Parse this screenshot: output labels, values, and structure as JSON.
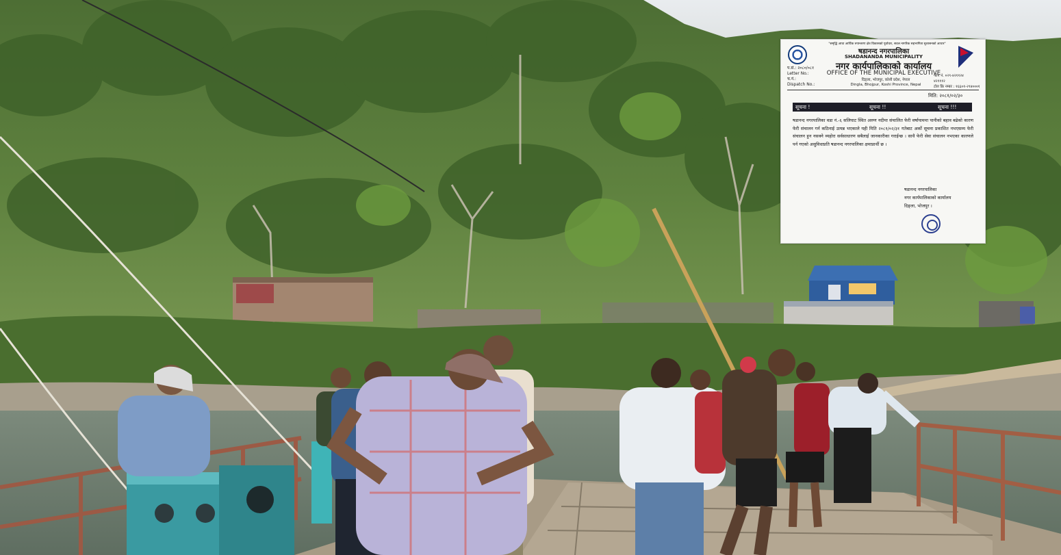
{
  "notice": {
    "slogan": "\"समृद्धि आधा आर्थिक रुपान्तरण क्षेत्र विकासको पूर्वाधार, सवल नागरिक सहभागिता सुशासनको आधार\"",
    "municipality_nepali": "षडानन्द नगरपालिका",
    "municipality_english": "SHADANANDA MUNICIPALITY",
    "office_nepali": "नगर कार्यपालिकाको कार्यालय",
    "office_english": "OFFICE OF THE MUNICIPAL EXECUTIVE",
    "meta_left": [
      "प.सं.: २०८०/०८१",
      "Letter No.:",
      "च.नं.:",
      "Dispatch No.:"
    ],
    "meta_right": [
      "फोन नं. ०२९-४२११२४",
      "४२१११२",
      "टोल फ्रि नम्बर : १६६०१-२९४०००१"
    ],
    "address": [
      "दिङ्ला, भोजपुर, कोशी प्रदेश, नेपाल",
      "Dingla, Bhojpur, Koshi Province, Nepal"
    ],
    "date": "मिति: २०८१/०२/३०",
    "banner": [
      "सूचना !",
      "सूचना !!",
      "सूचना !!!"
    ],
    "body": "षडानन्द नगरपालिका वडा नं.-६ सलिघाट स्थित अरुण नदीमा संचालित फेरी वर्षायाममा पानीको बहाव बढेको कारण फेरी संचालन गर्न कठिनाई उत्पन्न भएकाले यही मिति २०८१/०२/३१ गतेबाट अर्को सूचना प्रकाशित नभएसम्म फेरी संचालन हुन नसक्ने व्यहोरा सर्वसाधारण सबैलाई जानकारीका गराईन्छ । साथै फेरी सेवा संचालन नभएका कारणले पर्न गएको असुविधाप्रति षडानन्द नगरपालिका क्षमाप्रार्थी छ ।",
    "signature": [
      "षडानन्द नगरपालिका",
      "नगर कार्यपालिकाको कार्यालय",
      "दिङ्ला, भोजपुर ।"
    ]
  }
}
